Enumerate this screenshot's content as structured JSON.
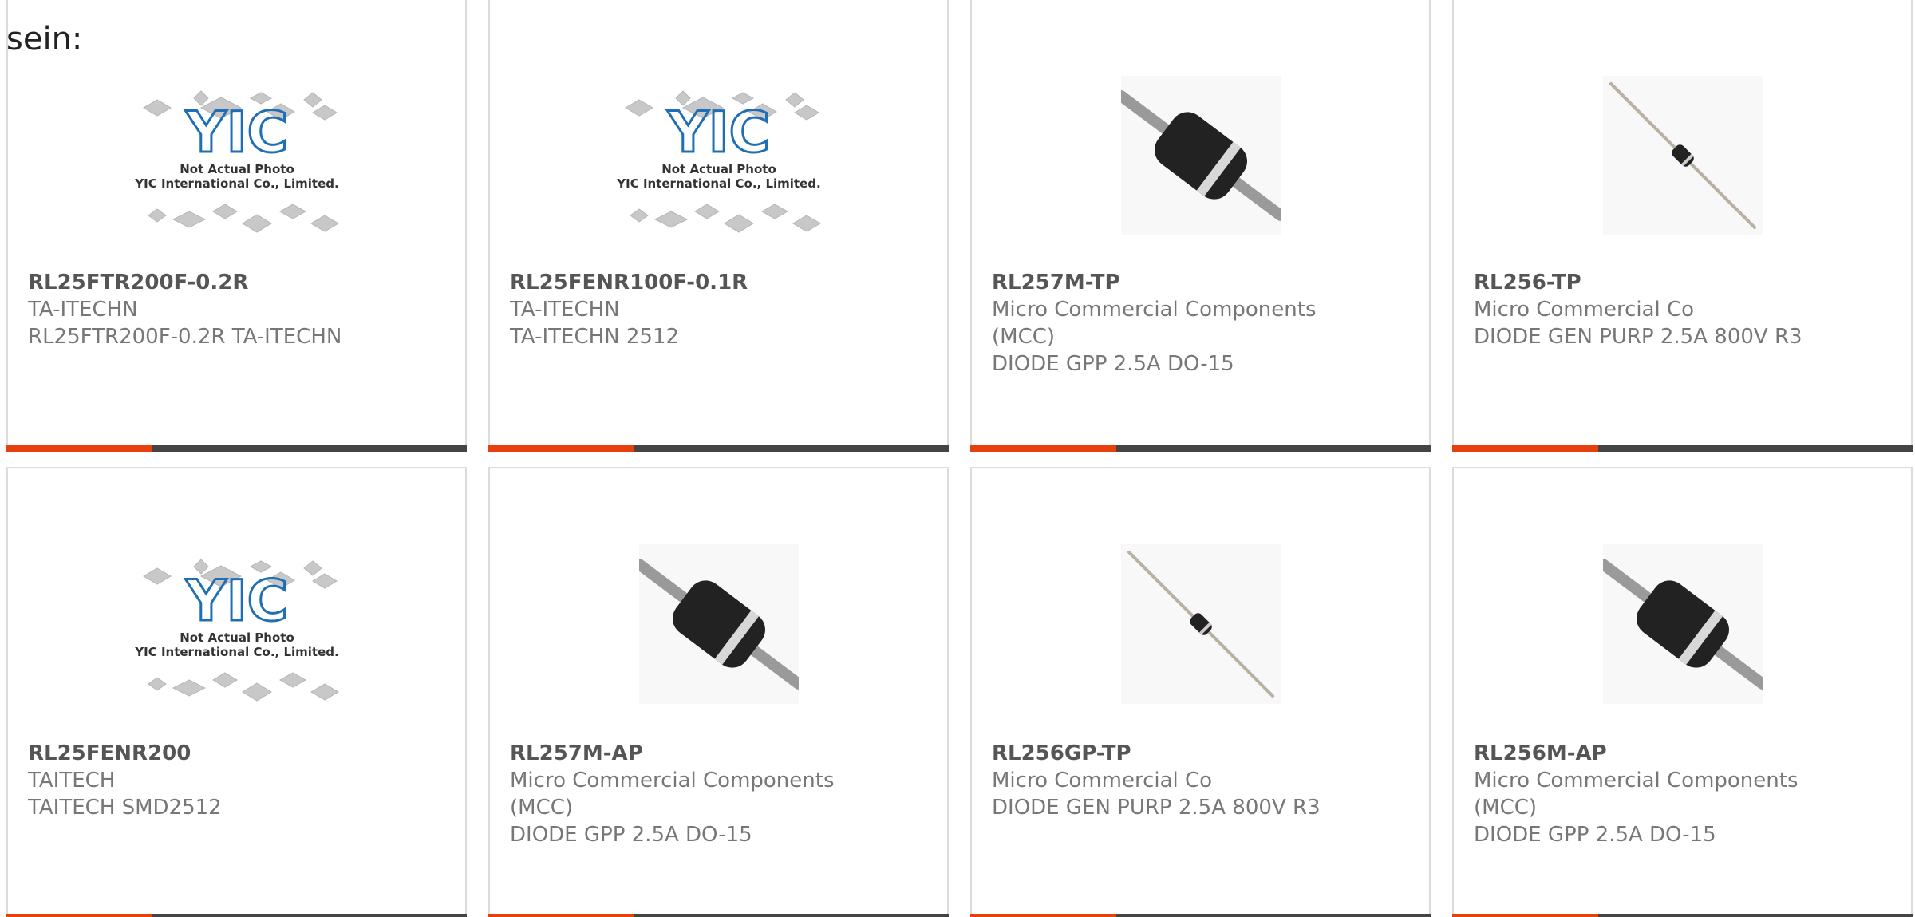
{
  "prefix_text": "sein:",
  "colors": {
    "accent": "#e8400c",
    "bar": "#444444"
  },
  "products": [
    {
      "part": "RL25FTR200F-0.2R",
      "lines": [
        "TA-ITECHN",
        "RL25FTR200F-0.2R TA-ITECHN"
      ],
      "image": "yic-placeholder",
      "caption1": "Not Actual Photo",
      "caption2": "YIC International Co., Limited."
    },
    {
      "part": "RL25FENR100F-0.1R",
      "lines": [
        "TA-ITECHN",
        "TA-ITECHN 2512"
      ],
      "image": "yic-placeholder",
      "caption1": "Not Actual Photo",
      "caption2": "YIC International Co., Limited."
    },
    {
      "part": "RL257M-TP",
      "lines": [
        "Micro Commercial Components",
        "(MCC)",
        "DIODE GPP 2.5A DO-15"
      ],
      "image": "diode-large"
    },
    {
      "part": "RL256-TP",
      "lines": [
        "Micro Commercial Co",
        "DIODE GEN PURP 2.5A 800V R3"
      ],
      "image": "diode-small"
    },
    {
      "part": "RL25FENR200",
      "lines": [
        "TAITECH",
        "TAITECH SMD2512"
      ],
      "image": "yic-placeholder",
      "caption1": "Not Actual Photo",
      "caption2": "YIC International Co., Limited."
    },
    {
      "part": "RL257M-AP",
      "lines": [
        "Micro Commercial Components",
        "(MCC)",
        "DIODE GPP 2.5A DO-15"
      ],
      "image": "diode-large"
    },
    {
      "part": "RL256GP-TP",
      "lines": [
        "Micro Commercial Co",
        "DIODE GEN PURP 2.5A 800V R3"
      ],
      "image": "diode-small"
    },
    {
      "part": "RL256M-AP",
      "lines": [
        "Micro Commercial Components",
        "(MCC)",
        "DIODE GPP 2.5A DO-15"
      ],
      "image": "diode-large"
    }
  ]
}
